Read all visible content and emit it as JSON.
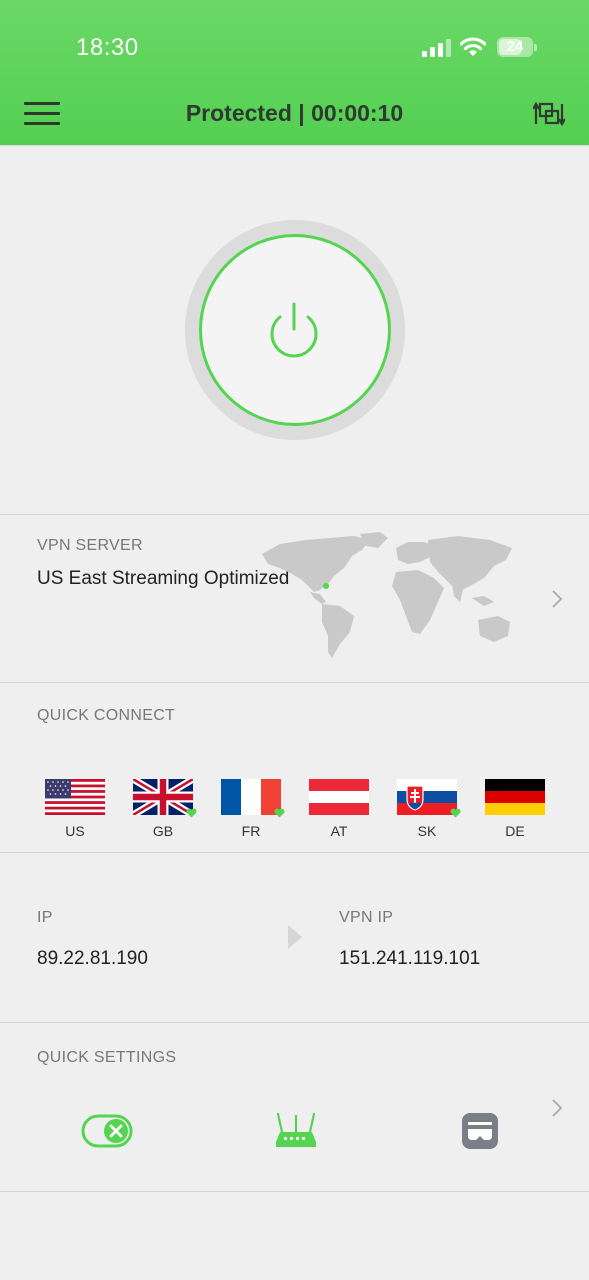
{
  "status_bar": {
    "time": "18:30",
    "battery": "24"
  },
  "header": {
    "title": "Protected | 00:00:10"
  },
  "vpn_server": {
    "label": "VPN SERVER",
    "value": "US East Streaming Optimized"
  },
  "quick_connect": {
    "label": "QUICK CONNECT",
    "countries": [
      {
        "code": "US",
        "favorite": false
      },
      {
        "code": "GB",
        "favorite": true
      },
      {
        "code": "FR",
        "favorite": true
      },
      {
        "code": "AT",
        "favorite": false
      },
      {
        "code": "SK",
        "favorite": true
      },
      {
        "code": "DE",
        "favorite": false
      }
    ]
  },
  "ip_info": {
    "ip_label": "IP",
    "ip_value": "89.22.81.190",
    "vpn_ip_label": "VPN IP",
    "vpn_ip_value": "151.241.119.101"
  },
  "quick_settings": {
    "label": "QUICK SETTINGS",
    "icons": [
      "kill-switch-icon",
      "router-icon",
      "stealth-mask-icon"
    ]
  },
  "colors": {
    "accent": "#55d452",
    "header_green": "#5dd35a",
    "background": "#efefef"
  }
}
